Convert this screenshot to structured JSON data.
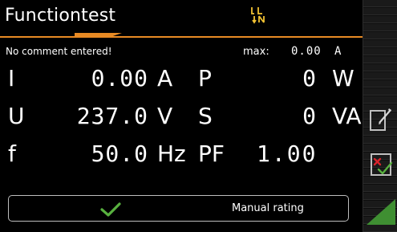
{
  "header": {
    "title": "Functiontest",
    "connection_icon": "phase-neutral-swap-icon",
    "accent_color": "#e88a24"
  },
  "info": {
    "comment": "No comment entered!",
    "max_label": "max:",
    "max_value": "0.00",
    "max_unit": "A"
  },
  "measurements": {
    "current": {
      "symbol": "I",
      "value": "0.00",
      "unit": "A"
    },
    "power": {
      "symbol": "P",
      "value": "0",
      "unit": "W"
    },
    "voltage": {
      "symbol": "U",
      "value": "237.0",
      "unit": "V"
    },
    "apparent_power": {
      "symbol": "S",
      "value": "0",
      "unit": "VA"
    },
    "frequency": {
      "symbol": "f",
      "value": "50.0",
      "unit": "Hz"
    },
    "power_factor": {
      "symbol": "PF",
      "value": "1.00"
    }
  },
  "rating": {
    "label": "Manual rating",
    "icon": "check-icon",
    "check_color": "#58b13f"
  },
  "sidebar": {
    "edit_icon": "edit-comment-icon",
    "rating_icon": "pass-fail-rating-icon",
    "corner_icon": "green-triangle-icon",
    "pass_color": "#58b13f",
    "fail_color": "#d8242b"
  }
}
